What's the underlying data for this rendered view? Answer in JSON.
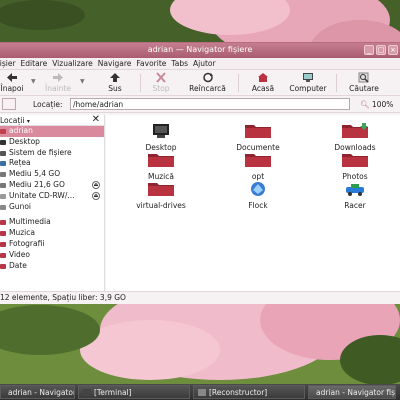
{
  "window": {
    "title": "adrian — Navigator fișiere",
    "buttons": [
      "_",
      "□",
      "×"
    ]
  },
  "menubar": {
    "items": [
      "Fișier",
      "Editare",
      "Vizualizare",
      "Navigare",
      "Favorite",
      "Tabs",
      "Ajutor"
    ]
  },
  "toolbar": {
    "back": "Înapoi",
    "forward": "Înainte",
    "up": "Sus",
    "stop": "Stop",
    "reload": "Reîncarcă",
    "home": "Acasă",
    "computer": "Computer",
    "search": "Căutare"
  },
  "locationbar": {
    "label": "Locație:",
    "value": "/home/adrian",
    "zoom": "100%"
  },
  "sidebar": {
    "title": "Locații",
    "close": "✕",
    "items": [
      {
        "label": "adrian",
        "color": "#c04050",
        "selected": true
      },
      {
        "label": "Desktop",
        "color": "#333"
      },
      {
        "label": "Sistem de fișiere",
        "color": "#555"
      },
      {
        "label": "Rețea",
        "color": "#3a6ea5"
      },
      {
        "label": "Mediu 5,4 GO",
        "color": "#777"
      },
      {
        "label": "Mediu 21,6 GO",
        "color": "#777"
      },
      {
        "label": "Unitate CD-RW/...",
        "color": "#999"
      },
      {
        "label": "Gunoi",
        "color": "#888"
      }
    ],
    "bookmarks": [
      {
        "label": "Multimedia",
        "color": "#b83548"
      },
      {
        "label": "Muzica",
        "color": "#b83548"
      },
      {
        "label": "Fotografii",
        "color": "#b83548"
      },
      {
        "label": "Video",
        "color": "#b83548"
      },
      {
        "label": "Date",
        "color": "#b83548"
      }
    ]
  },
  "files": [
    {
      "label": "Desktop",
      "icon": "desktop-icon"
    },
    {
      "label": "Documente",
      "icon": "folder-icon"
    },
    {
      "label": "Downloads",
      "icon": "download-folder-icon"
    },
    {
      "label": "Muzică",
      "icon": "folder-icon"
    },
    {
      "label": "opt",
      "icon": "folder-icon"
    },
    {
      "label": "Photos",
      "icon": "folder-icon"
    },
    {
      "label": "virtual-drives",
      "icon": "folder-icon"
    },
    {
      "label": "Flock",
      "icon": "flock-icon"
    },
    {
      "label": "Racer",
      "icon": "racer-icon"
    }
  ],
  "statusbar": {
    "text": "12 elemente, Spațiu liber: 3,9 GO"
  },
  "taskbar": {
    "tasks": [
      "adrian - Navigator fi...",
      "[Terminal]",
      "[Reconstructor]",
      "adrian - Navigator fișiere"
    ]
  },
  "colors": {
    "accent": "#d98a9c",
    "folder": "#b8323f",
    "titlebar": "#b86a7e"
  }
}
